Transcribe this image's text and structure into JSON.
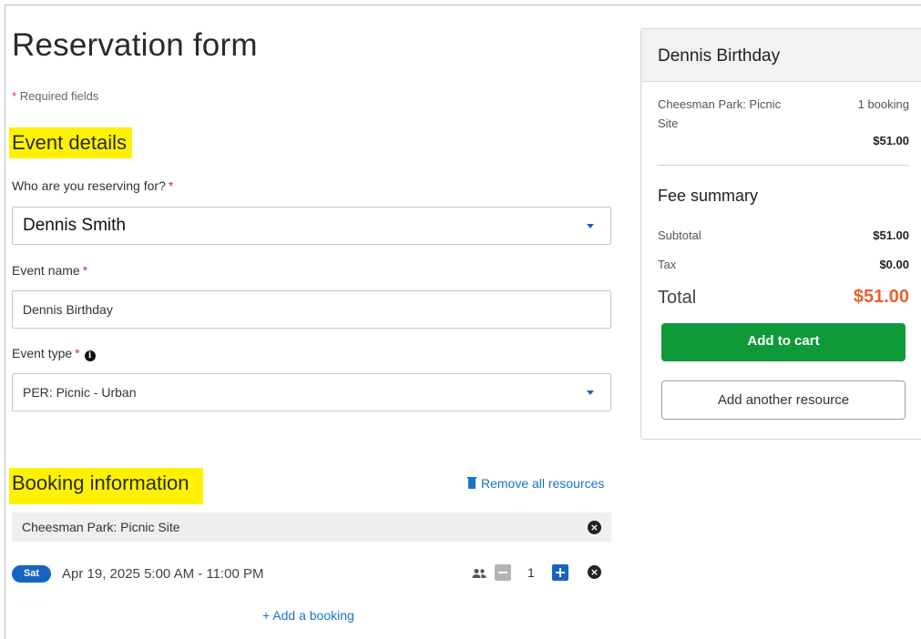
{
  "page": {
    "title": "Reservation form",
    "required_note_star": "*",
    "required_note": "Required fields"
  },
  "event_details": {
    "section_title": "Event details",
    "reserving_for": {
      "label": "Who are you reserving for?",
      "star": "*",
      "value": "Dennis Smith"
    },
    "event_name": {
      "label": "Event name",
      "star": "*",
      "value": "Dennis Birthday"
    },
    "event_type": {
      "label": "Event type",
      "star": "*",
      "info_icon": "i",
      "value": "PER: Picnic - Urban"
    }
  },
  "booking_information": {
    "section_title": "Booking information",
    "remove_all_label": "Remove all resources",
    "resource_name": "Cheesman Park: Picnic Site",
    "booking": {
      "day": "Sat",
      "datetime": "Apr 19, 2025 5:00 AM - 11:00 PM",
      "quantity": "1"
    },
    "add_booking_label": "+ Add a booking"
  },
  "summary": {
    "title": "Dennis Birthday",
    "resource_line": "Cheesman Park: Picnic Site",
    "resource_count": "1 booking",
    "resource_price": "$51.00",
    "fee_summary_title": "Fee summary",
    "subtotal_label": "Subtotal",
    "subtotal_value": "$51.00",
    "tax_label": "Tax",
    "tax_value": "$0.00",
    "total_label": "Total",
    "total_value": "$51.00",
    "add_to_cart_label": "Add to cart",
    "add_another_label": "Add another resource"
  },
  "colors": {
    "highlight": "#fff200",
    "primary_blue": "#1565c0",
    "link_blue": "#1a73c8",
    "cart_green": "#0f9a3a",
    "total_orange": "#e8612c",
    "required_red": "#d0302f"
  },
  "icons": {
    "dropdown": "chevron-down-icon",
    "info": "info-icon",
    "trash": "trash-icon",
    "remove": "close-circle-icon",
    "people": "people-icon",
    "minus": "minus-icon",
    "plus": "plus-icon"
  }
}
